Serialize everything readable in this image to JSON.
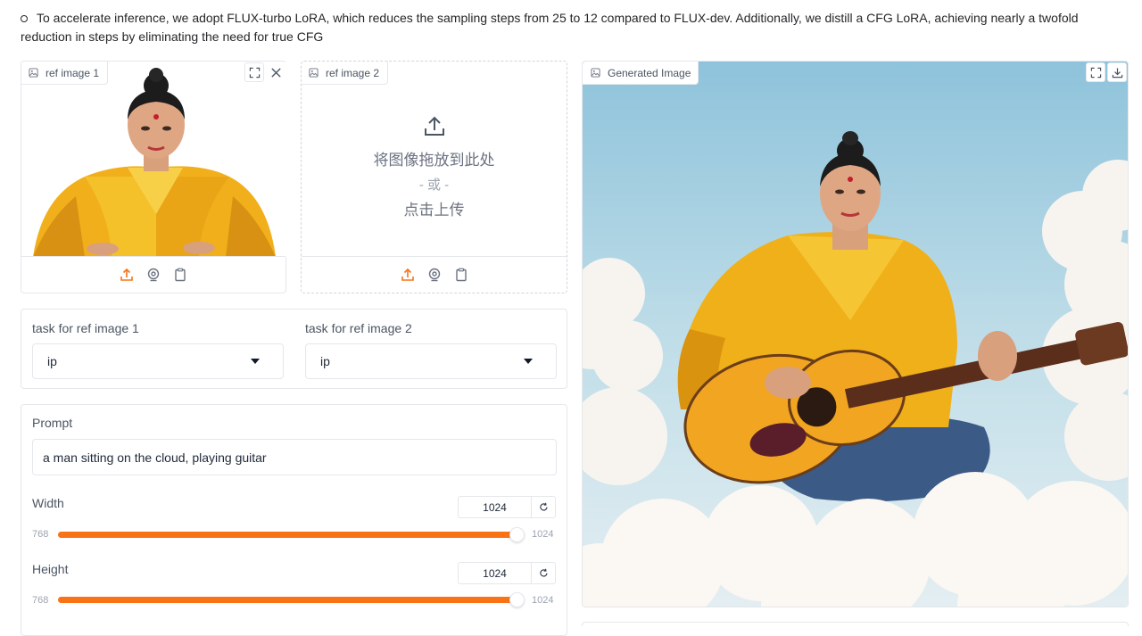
{
  "intro": {
    "text": "To accelerate inference, we adopt FLUX-turbo LoRA, which reduces the sampling steps from 25 to 12 compared to FLUX-dev. Additionally, we distill a CFG LoRA, achieving nearly a twofold reduction in steps by eliminating the need for true CFG"
  },
  "ref1": {
    "label": "ref image 1"
  },
  "ref2": {
    "label": "ref image 2",
    "drop_line1": "将图像拖放到此处",
    "drop_line2": "- 或 -",
    "drop_line3": "点击上传"
  },
  "tasks": {
    "task1_label": "task for ref image 1",
    "task1_value": "ip",
    "task2_label": "task for ref image 2",
    "task2_value": "ip"
  },
  "prompt": {
    "label": "Prompt",
    "value": "a man sitting on the cloud, playing guitar"
  },
  "width": {
    "label": "Width",
    "value": "1024",
    "min": "768",
    "max": "1024",
    "fraction": 1.0
  },
  "height": {
    "label": "Height",
    "value": "1024",
    "min": "768",
    "max": "1024",
    "fraction": 1.0
  },
  "output": {
    "label": "Generated Image"
  },
  "colors": {
    "accent": "#f97316",
    "border": "#e5e7eb",
    "sky_top": "#8ec3db",
    "sky_bottom": "#e4eef2",
    "robe": "#f0b019"
  },
  "icons": {
    "image": "image-icon",
    "fullscreen": "fullscreen-icon",
    "close": "close-icon",
    "download": "download-icon",
    "upload": "upload-icon",
    "webcam": "webcam-icon",
    "clipboard": "clipboard-icon",
    "reset": "reset-icon"
  }
}
